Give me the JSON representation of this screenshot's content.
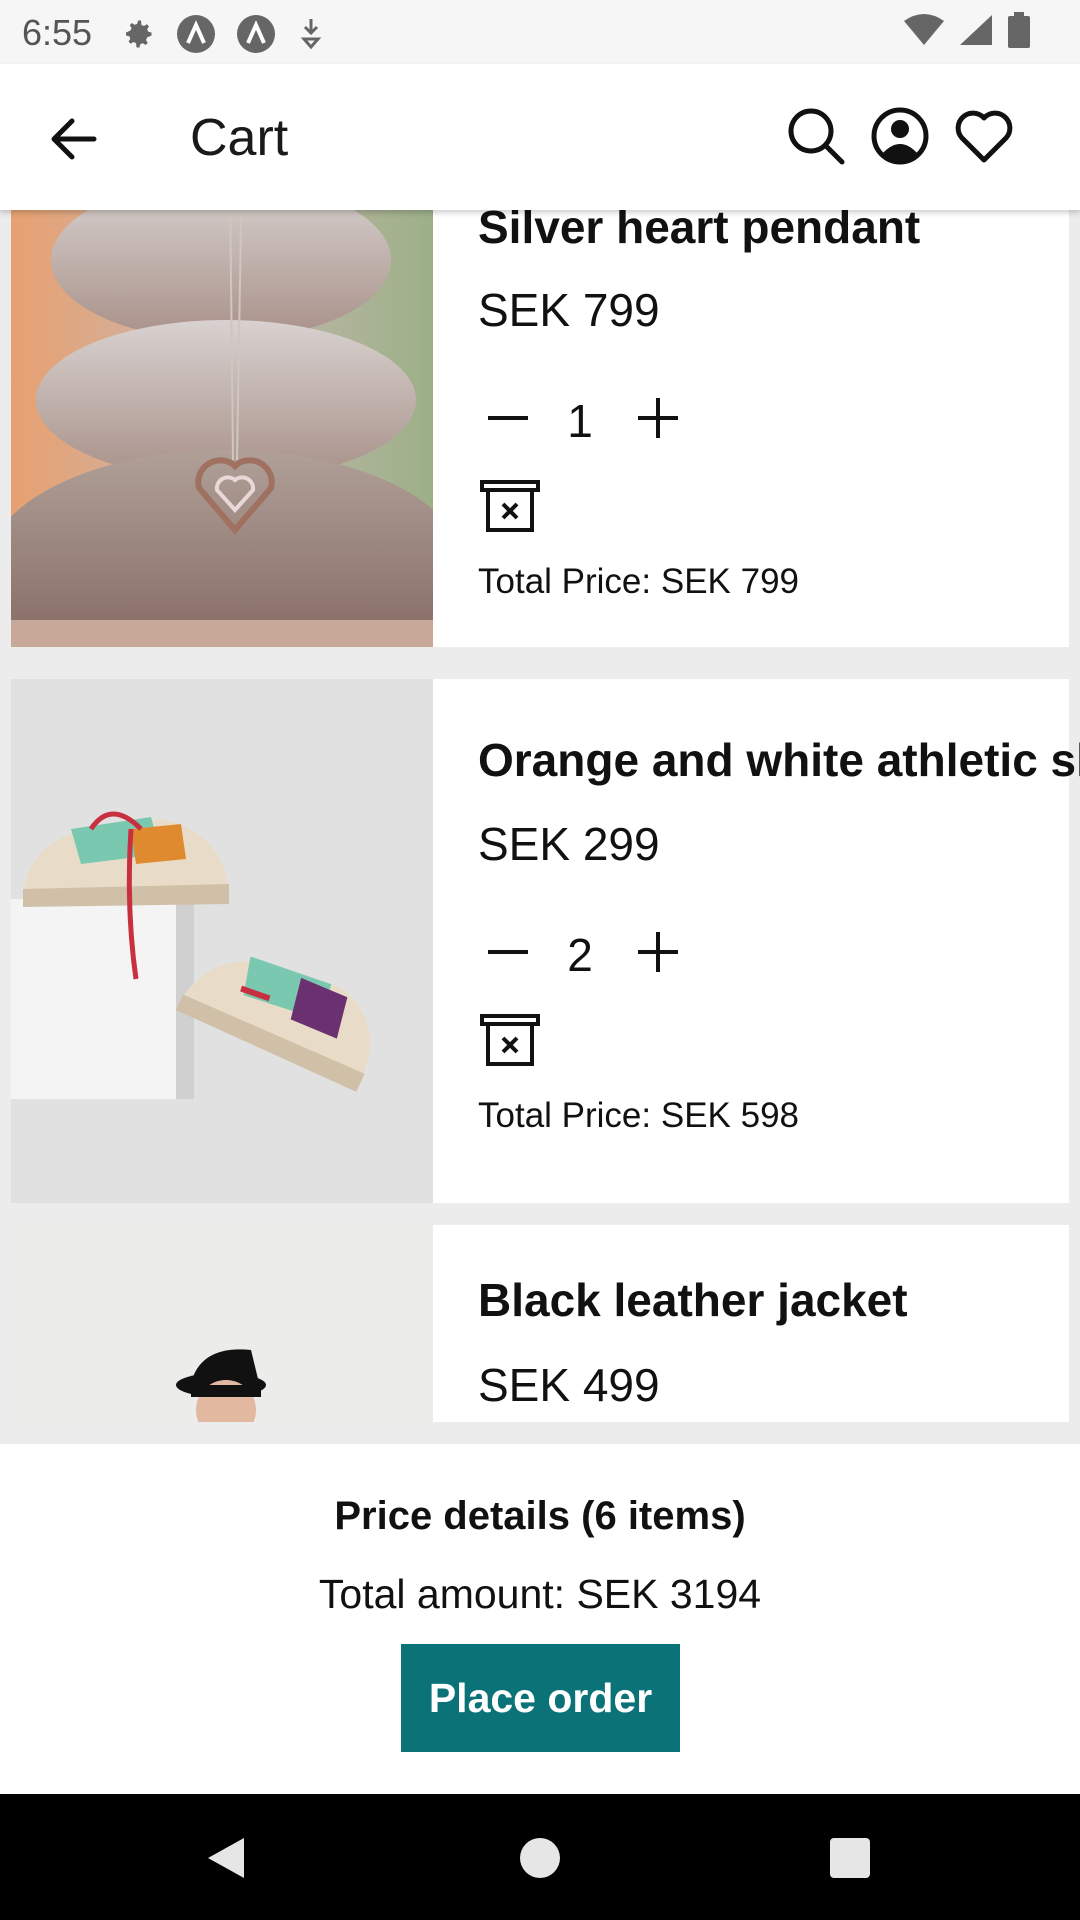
{
  "status_bar": {
    "time": "6:55",
    "icons": [
      "settings-icon",
      "a-icon",
      "a-icon",
      "download-icon",
      "wifi-icon",
      "signal-icon",
      "battery-icon"
    ]
  },
  "app_bar": {
    "title": "Cart",
    "icons": [
      "back-arrow-icon",
      "search-icon",
      "account-icon",
      "heart-icon"
    ]
  },
  "cart": {
    "items": [
      {
        "name": "Silver heart pendant",
        "price": "SEK 799",
        "quantity": "1",
        "total": "Total Price: SEK 799",
        "image": "heart-pendant-on-stones"
      },
      {
        "name": "Orange and white athletic shoes",
        "price": "SEK 299",
        "quantity": "2",
        "total": "Total Price: SEK 598",
        "image": "athletic-shoes"
      },
      {
        "name": "Black leather jacket",
        "price": "SEK 499",
        "image": "man-in-black-hat"
      }
    ]
  },
  "summary": {
    "title": "Price details (6 items)",
    "total": "Total amount: SEK 3194",
    "place_order_label": "Place order"
  },
  "colors": {
    "accent": "#0b7378",
    "background": "#ececec",
    "card": "#ffffff"
  }
}
